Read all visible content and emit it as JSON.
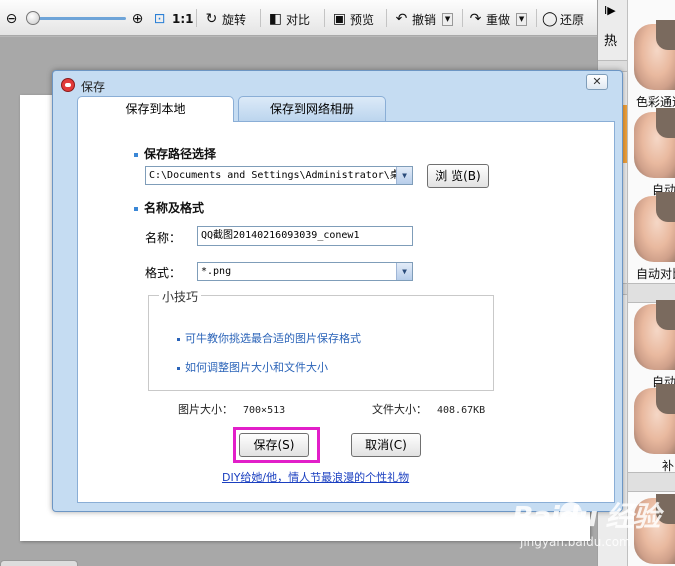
{
  "toolbar": {
    "ratio_label": "1:1",
    "rotate_label": "旋转",
    "compare_label": "对比",
    "preview_label": "预览",
    "undo_label": "撤销",
    "redo_label": "重做",
    "restore_label": "还原",
    "zoom_level_fraction": 0.0
  },
  "right_panel": {
    "tab_label": "热",
    "toggle_glyph": "I▶",
    "thumbnails": [
      {
        "label": "色彩通道"
      },
      {
        "label": "自动"
      },
      {
        "label": "自动对比"
      },
      {
        "label": "自动"
      },
      {
        "label": "补"
      },
      {
        "label": ""
      }
    ]
  },
  "dialog": {
    "title": "保存",
    "close_glyph": "✕",
    "tabs": [
      {
        "label": "保存到本地",
        "active": true
      },
      {
        "label": "保存到网络相册",
        "active": false
      }
    ],
    "path_section_title": "保存路径选择",
    "path_value": "C:\\Documents and Settings\\Administrator\\桌",
    "browse_label": "浏 览(B)",
    "name_section_title": "名称及格式",
    "name_label": "名称：",
    "name_value": "QQ截图20140216093039_conew1",
    "format_label": "格式：",
    "format_value": "*.png",
    "tips_title": "小技巧",
    "tip_links": [
      "可牛教你挑选最合适的图片保存格式",
      "如何调整图片大小和文件大小"
    ],
    "image_size_label": "图片大小：",
    "image_size_value": "700×513",
    "file_size_label": "文件大小：",
    "file_size_value": "408.67KB",
    "save_label": "保存(S)",
    "cancel_label": "取消(C)",
    "promo_link": "DIY给她/他，情人节最浪漫的个性礼物"
  },
  "watermark": {
    "brand": "Baidu 经验",
    "url": "jingyan.baidu.com"
  }
}
